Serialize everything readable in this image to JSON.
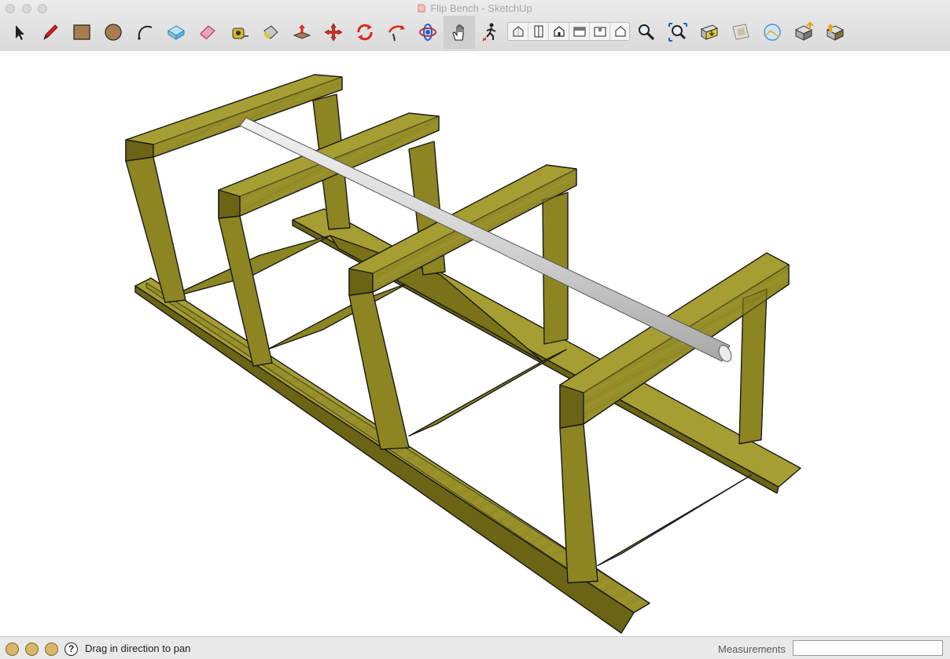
{
  "window": {
    "title": "Flip Bench - SketchUp",
    "controls": [
      "close",
      "minimize",
      "zoom"
    ]
  },
  "toolbar": {
    "tools": [
      {
        "id": "select",
        "icon": "select-arrow-icon"
      },
      {
        "id": "pencil",
        "icon": "pencil-icon"
      },
      {
        "id": "rectangle",
        "icon": "rectangle-icon"
      },
      {
        "id": "circle",
        "icon": "circle-icon"
      },
      {
        "id": "arc",
        "icon": "arc-icon"
      },
      {
        "id": "make-component",
        "icon": "component-icon"
      },
      {
        "id": "eraser",
        "icon": "eraser-icon"
      },
      {
        "id": "tape-measure",
        "icon": "tape-measure-icon"
      },
      {
        "id": "paint-bucket",
        "icon": "paint-bucket-icon"
      },
      {
        "id": "push-pull",
        "icon": "push-pull-icon"
      },
      {
        "id": "move",
        "icon": "move-icon"
      },
      {
        "id": "rotate",
        "icon": "rotate-icon"
      },
      {
        "id": "follow-me",
        "icon": "follow-me-icon"
      },
      {
        "id": "orbit",
        "icon": "orbit-icon"
      },
      {
        "id": "pan",
        "icon": "pan-hand-icon",
        "active": true
      },
      {
        "id": "walk",
        "icon": "walk-icon"
      },
      {
        "id": "zoom",
        "icon": "zoom-magnifier-icon"
      },
      {
        "id": "zoom-extents",
        "icon": "zoom-extents-icon"
      },
      {
        "id": "warehouse-get-models",
        "icon": "warehouse-icon"
      },
      {
        "id": "share-model",
        "icon": "share-model-icon"
      },
      {
        "id": "photo-textures",
        "icon": "photo-textures-icon"
      },
      {
        "id": "geo-location",
        "icon": "globe-icon"
      },
      {
        "id": "extension-warehouse",
        "icon": "extension-warehouse-icon"
      },
      {
        "id": "share-component",
        "icon": "share-component-icon"
      }
    ],
    "views": [
      {
        "id": "iso",
        "icon": "iso-view-icon"
      },
      {
        "id": "top",
        "icon": "top-view-icon"
      },
      {
        "id": "front",
        "icon": "front-view-icon"
      },
      {
        "id": "right",
        "icon": "right-view-icon"
      },
      {
        "id": "back",
        "icon": "back-view-icon"
      },
      {
        "id": "left",
        "icon": "left-view-icon"
      }
    ]
  },
  "colors": {
    "wood": "#8c8522",
    "wood_dark": "#6b6414",
    "wood_light": "#a69e33",
    "rod": "#cfcfcf",
    "edge": "#1a1a1a"
  },
  "status": {
    "message": "Drag in direction to pan",
    "icons": [
      "geo-location-icon",
      "credits-icon",
      "sign-in-icon",
      "help-icon"
    ],
    "help_glyph": "?",
    "measurements_label": "Measurements",
    "measurements_value": ""
  }
}
